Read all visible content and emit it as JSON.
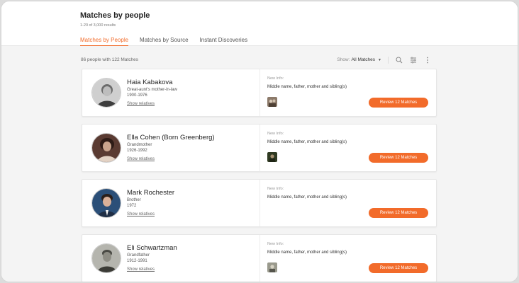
{
  "header": {
    "title": "Matches by people",
    "subtitle": "1-20 of 3,000 results"
  },
  "tabs": [
    {
      "label": "Matches by People",
      "active": true
    },
    {
      "label": "Matches by Source",
      "active": false
    },
    {
      "label": "Instant Discoveries",
      "active": false
    }
  ],
  "summary": "86 people with 122 Matches",
  "toolbar": {
    "show_label": "Show:",
    "show_value": "All Matches"
  },
  "cards": [
    {
      "name": "Haia Kabakova",
      "relation": "Great-aunt's mother-in-law",
      "years": "1900-1976",
      "show_relatives": "Show relatives",
      "new_info_label": "New Info:",
      "new_info": "Middle name, father, mother and sibling(s)",
      "has_thumb": true,
      "review": "Review 12 Matches"
    },
    {
      "name": "Ella Cohen (Born Greenberg)",
      "relation": "Grandmother",
      "years": "1926-1992",
      "show_relatives": "Show relatives",
      "new_info_label": "New Info:",
      "new_info": "Middle name, father, mother and sibling(s)",
      "has_thumb": true,
      "review": "Review 12 Matches"
    },
    {
      "name": "Mark Rochester",
      "relation": "Brother",
      "years": "1972",
      "show_relatives": "Show relatives",
      "new_info_label": "New Info:",
      "new_info": "Middle name, father, mother and sibling(s)",
      "has_thumb": false,
      "review": "Review 12 Matches"
    },
    {
      "name": "Eli Schwartzman",
      "relation": "Grandfather",
      "years": "1912-1991",
      "show_relatives": "Show relatives",
      "new_info_label": "New Info:",
      "new_info": "Middle name, father, mother and sibling(s)",
      "has_thumb": true,
      "review": "Review 12 Matches"
    }
  ],
  "colors": {
    "accent": "#f26b2a",
    "background": "#f4f4f4"
  },
  "icons": [
    "search-icon",
    "filter-icon",
    "more-vertical-icon",
    "chevron-down-icon"
  ]
}
